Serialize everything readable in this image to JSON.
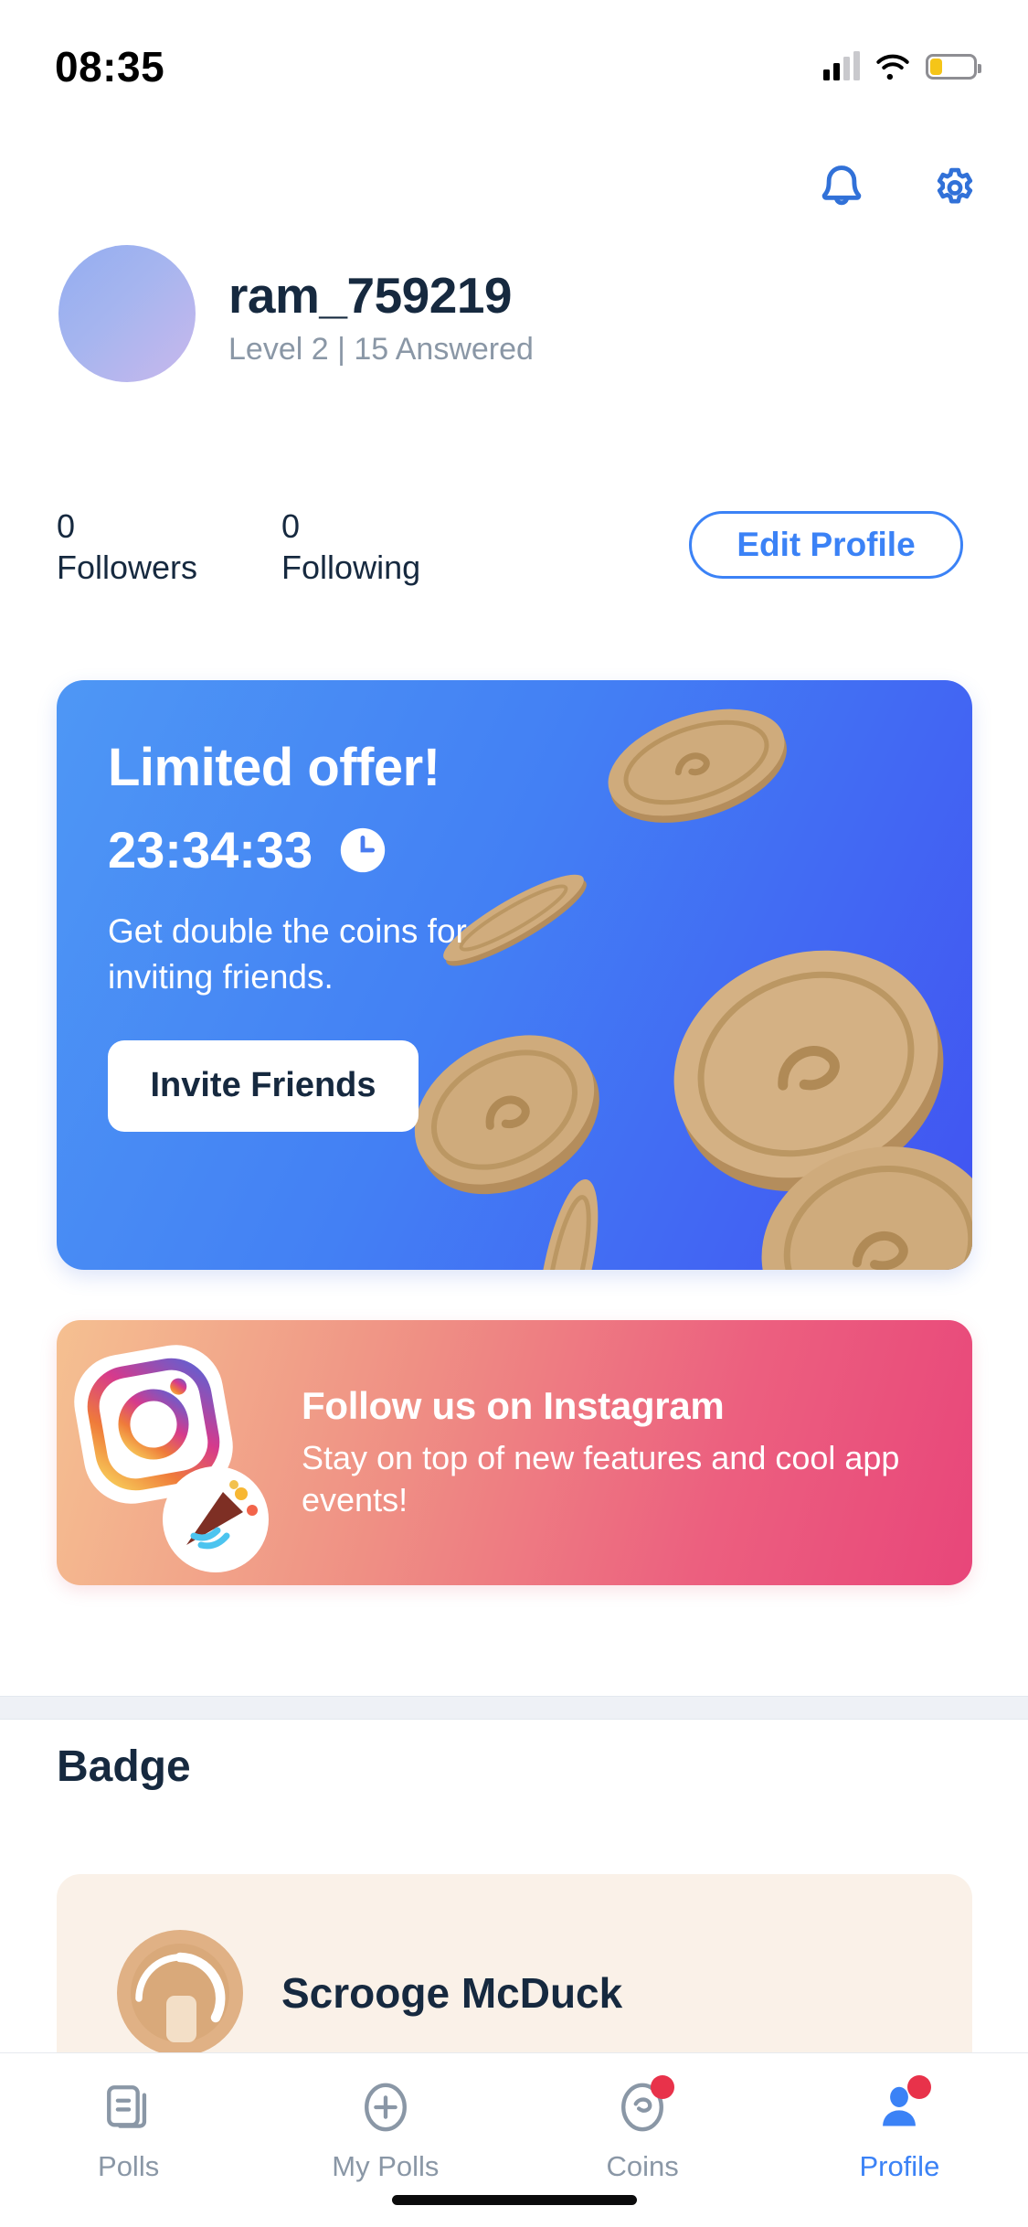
{
  "status_bar": {
    "time": "08:35",
    "signal_icon": "signal-bars-icon",
    "wifi_icon": "wifi-icon",
    "battery_icon": "battery-low-icon",
    "battery_color": "#f5c518"
  },
  "header": {
    "notifications_icon": "bell-icon",
    "settings_icon": "gear-icon",
    "icon_color": "#3171d8"
  },
  "profile": {
    "avatar_icon": "avatar-placeholder",
    "username": "ram_759219",
    "level_line": "Level 2 | 15 Answered",
    "stats": [
      {
        "value": "0",
        "label": "Followers"
      },
      {
        "value": "0",
        "label": "Following"
      }
    ],
    "edit_button": "Edit Profile",
    "accent_color": "#3b82f6",
    "text_color": "#16293f"
  },
  "offer_card": {
    "heading": "Limited offer!",
    "countdown": "23:34:33",
    "clock_icon": "clock-icon",
    "subtitle": "Get double the coins for inviting friends.",
    "cta": "Invite Friends",
    "background_from": "#4e97f5",
    "background_to": "#4153f2",
    "coin_icon": "coin-icon"
  },
  "instagram_card": {
    "heading": "Follow us on Instagram",
    "subtitle": "Stay on top of new features and cool app events!",
    "instagram_icon": "instagram-icon",
    "party_icon": "party-popper-icon",
    "background_from": "#f5c091",
    "background_to": "#e8467a"
  },
  "badge_section": {
    "title": "Badge",
    "items": [
      {
        "name": "Scrooge McDuck",
        "icon": "coin-badge-icon"
      }
    ]
  },
  "tab_bar": {
    "tabs": [
      {
        "label": "Polls",
        "icon": "polls-icon",
        "active": false,
        "badge": false
      },
      {
        "label": "My Polls",
        "icon": "plus-circle-icon",
        "active": false,
        "badge": false
      },
      {
        "label": "Coins",
        "icon": "coin-icon",
        "active": false,
        "badge": true
      },
      {
        "label": "Profile",
        "icon": "person-icon",
        "active": true,
        "badge": true
      }
    ],
    "active_color": "#3b82f6",
    "inactive_color": "#8a97a6",
    "badge_color": "#e8324a"
  }
}
